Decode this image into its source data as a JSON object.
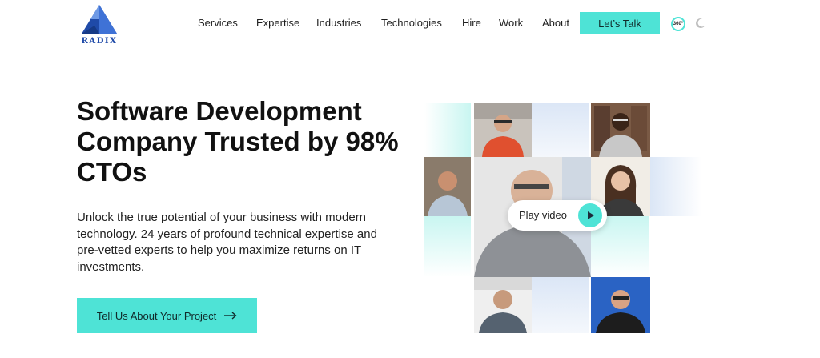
{
  "brand": {
    "name": "RADIX",
    "accent": "#4ee3d6",
    "logo_blue": "#1f4aa8"
  },
  "nav": {
    "items": [
      "Services",
      "Expertise",
      "Industries",
      "Technologies",
      "Hire",
      "Work",
      "About"
    ],
    "cta_label": "Let’s Talk",
    "badge_label": "360°",
    "theme_icon": "moon-icon"
  },
  "hero": {
    "title": "Software Development Company Trusted by 98% CTOs",
    "description": "Unlock the true potential of your business with modern technology. 24 years of profound technical expertise and pre-vetted experts to help you maximize returns on IT investments.",
    "button_label": "Tell Us About Your Project",
    "button_icon": "arrow-right-icon"
  },
  "video": {
    "play_label": "Play video",
    "play_icon": "play-icon"
  }
}
